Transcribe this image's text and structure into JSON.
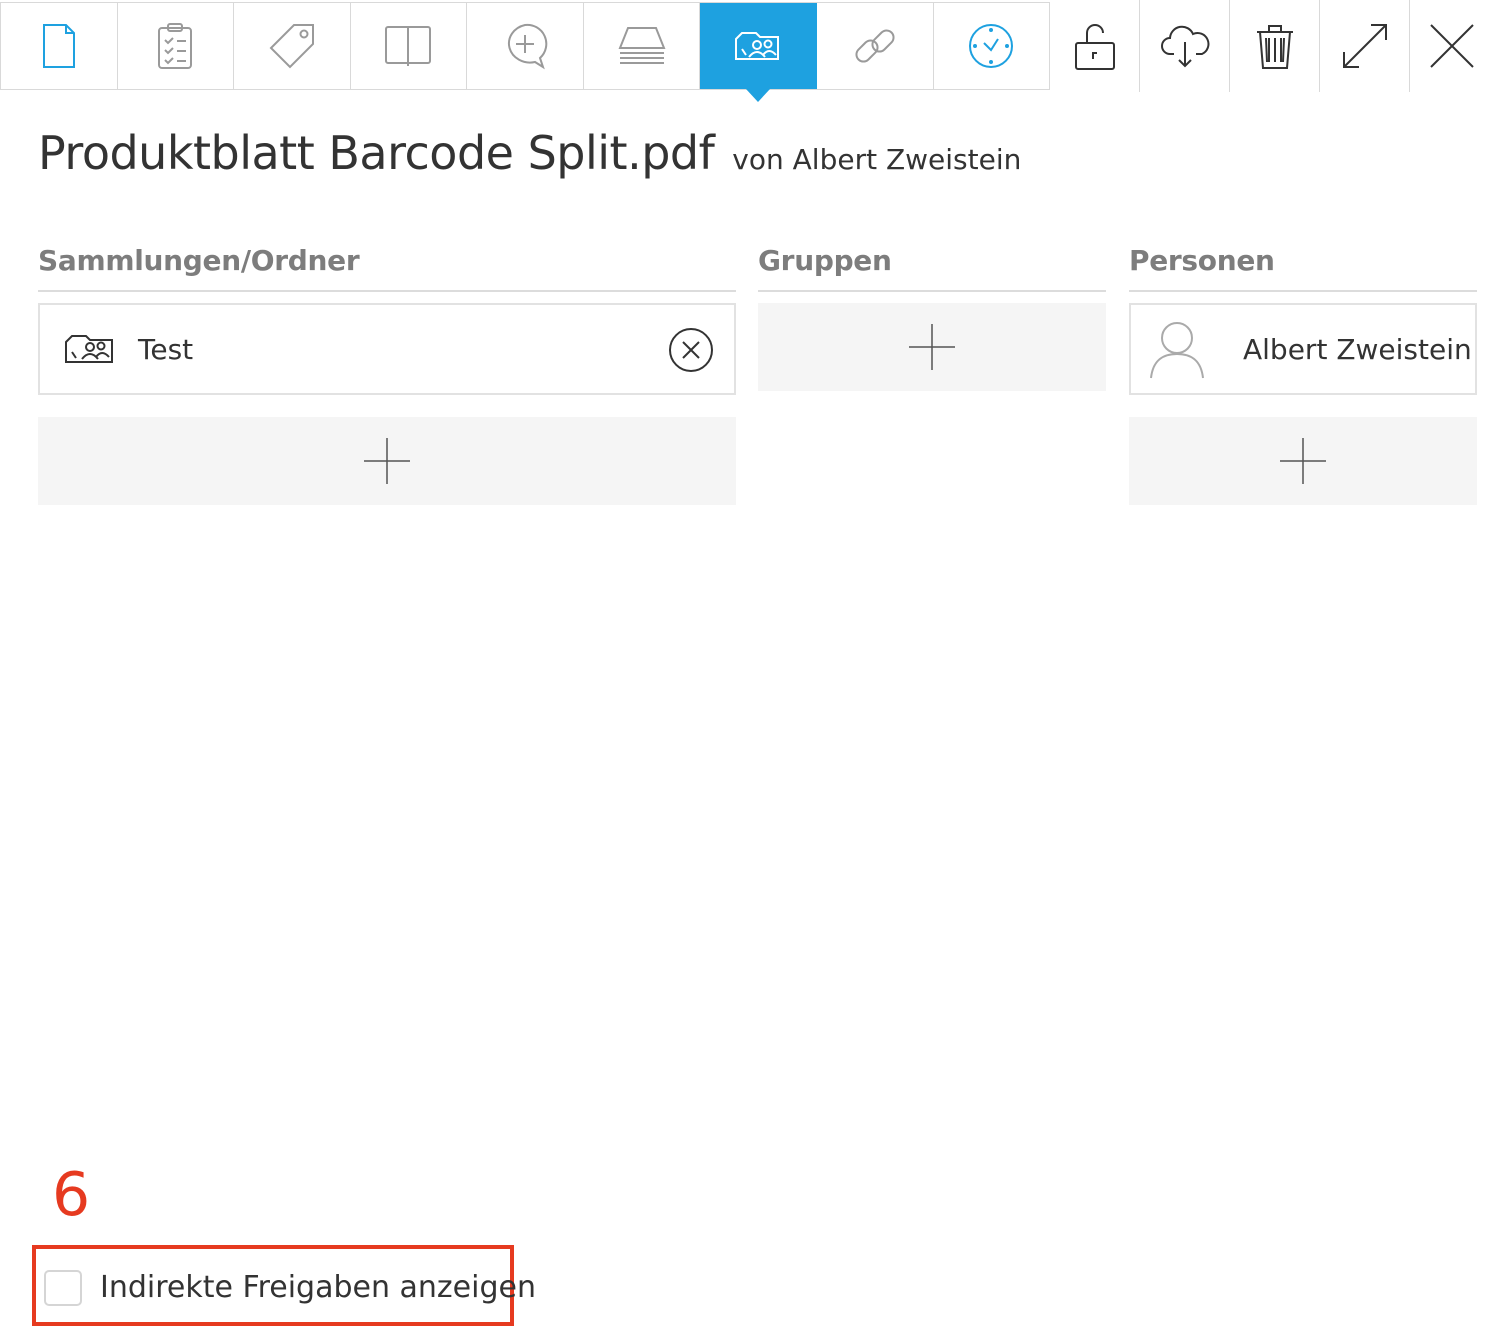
{
  "toolbar": {
    "tabs": [
      {
        "icon": "document-icon"
      },
      {
        "icon": "clipboard-checklist-icon"
      },
      {
        "icon": "tag-icon"
      },
      {
        "icon": "book-icon"
      },
      {
        "icon": "comment-add-icon"
      },
      {
        "icon": "stack-icon"
      },
      {
        "icon": "shared-folder-icon",
        "active": true
      },
      {
        "icon": "link-icon"
      },
      {
        "icon": "clock-icon"
      }
    ],
    "actions": [
      {
        "icon": "unlock-icon"
      },
      {
        "icon": "cloud-download-icon"
      },
      {
        "icon": "trash-icon"
      },
      {
        "icon": "expand-icon"
      },
      {
        "icon": "close-icon"
      }
    ],
    "accent_color": "#1ea1e0"
  },
  "document": {
    "title": "Produktblatt Barcode Split.pdf",
    "author": "von Albert Zweistein"
  },
  "sections": {
    "collections": {
      "heading": "Sammlungen/Ordner",
      "items": [
        {
          "label": "Test",
          "icon": "shared-folder-icon"
        }
      ]
    },
    "groups": {
      "heading": "Gruppen"
    },
    "persons": {
      "heading": "Personen",
      "items": [
        {
          "label": "Albert Zweistein",
          "icon": "user-icon"
        }
      ]
    }
  },
  "footer": {
    "step_number": "6",
    "checkbox_label": "Indirekte Freigaben anzeigen",
    "checkbox_checked": false,
    "highlight_color": "#e63a20"
  }
}
